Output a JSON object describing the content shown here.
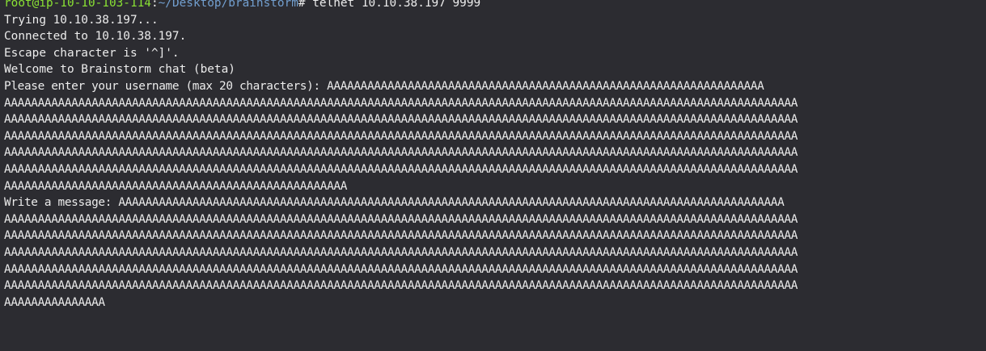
{
  "prompt": {
    "user_host": "root@ip-10-10-103-114",
    "separator": ":",
    "path": "~/Desktop/brainstorm",
    "symbol": "#",
    "command": " telnet 10.10.38.197 9999"
  },
  "output": [
    "Trying 10.10.38.197...",
    "Connected to 10.10.38.197.",
    "Escape character is '^]'.",
    "Welcome to Brainstorm chat (beta)",
    "Please enter your username (max 20 characters): AAAAAAAAAAAAAAAAAAAAAAAAAAAAAAAAAAAAAAAAAAAAAAAAAAAAAAAAAAAAAAAAA",
    "AAAAAAAAAAAAAAAAAAAAAAAAAAAAAAAAAAAAAAAAAAAAAAAAAAAAAAAAAAAAAAAAAAAAAAAAAAAAAAAAAAAAAAAAAAAAAAAAAAAAAAAAAAAAAAAAAAAAAA",
    "AAAAAAAAAAAAAAAAAAAAAAAAAAAAAAAAAAAAAAAAAAAAAAAAAAAAAAAAAAAAAAAAAAAAAAAAAAAAAAAAAAAAAAAAAAAAAAAAAAAAAAAAAAAAAAAAAAAAAA",
    "AAAAAAAAAAAAAAAAAAAAAAAAAAAAAAAAAAAAAAAAAAAAAAAAAAAAAAAAAAAAAAAAAAAAAAAAAAAAAAAAAAAAAAAAAAAAAAAAAAAAAAAAAAAAAAAAAAAAAA",
    "AAAAAAAAAAAAAAAAAAAAAAAAAAAAAAAAAAAAAAAAAAAAAAAAAAAAAAAAAAAAAAAAAAAAAAAAAAAAAAAAAAAAAAAAAAAAAAAAAAAAAAAAAAAAAAAAAAAAAA",
    "AAAAAAAAAAAAAAAAAAAAAAAAAAAAAAAAAAAAAAAAAAAAAAAAAAAAAAAAAAAAAAAAAAAAAAAAAAAAAAAAAAAAAAAAAAAAAAAAAAAAAAAAAAAAAAAAAAAAAA",
    "AAAAAAAAAAAAAAAAAAAAAAAAAAAAAAAAAAAAAAAAAAAAAAAAAAA",
    "Write a message: AAAAAAAAAAAAAAAAAAAAAAAAAAAAAAAAAAAAAAAAAAAAAAAAAAAAAAAAAAAAAAAAAAAAAAAAAAAAAAAAAAAAAAAAAAAAAAAAAAA",
    "AAAAAAAAAAAAAAAAAAAAAAAAAAAAAAAAAAAAAAAAAAAAAAAAAAAAAAAAAAAAAAAAAAAAAAAAAAAAAAAAAAAAAAAAAAAAAAAAAAAAAAAAAAAAAAAAAAAAAA",
    "AAAAAAAAAAAAAAAAAAAAAAAAAAAAAAAAAAAAAAAAAAAAAAAAAAAAAAAAAAAAAAAAAAAAAAAAAAAAAAAAAAAAAAAAAAAAAAAAAAAAAAAAAAAAAAAAAAAAAA",
    "AAAAAAAAAAAAAAAAAAAAAAAAAAAAAAAAAAAAAAAAAAAAAAAAAAAAAAAAAAAAAAAAAAAAAAAAAAAAAAAAAAAAAAAAAAAAAAAAAAAAAAAAAAAAAAAAAAAAAA",
    "AAAAAAAAAAAAAAAAAAAAAAAAAAAAAAAAAAAAAAAAAAAAAAAAAAAAAAAAAAAAAAAAAAAAAAAAAAAAAAAAAAAAAAAAAAAAAAAAAAAAAAAAAAAAAAAAAAAAAA",
    "AAAAAAAAAAAAAAAAAAAAAAAAAAAAAAAAAAAAAAAAAAAAAAAAAAAAAAAAAAAAAAAAAAAAAAAAAAAAAAAAAAAAAAAAAAAAAAAAAAAAAAAAAAAAAAAAAAAAAA",
    "AAAAAAAAAAAAAAA"
  ],
  "colors": {
    "background": "#2c2c31",
    "text": "#ececec",
    "user_host": "#8ae234",
    "path": "#729fcf"
  }
}
